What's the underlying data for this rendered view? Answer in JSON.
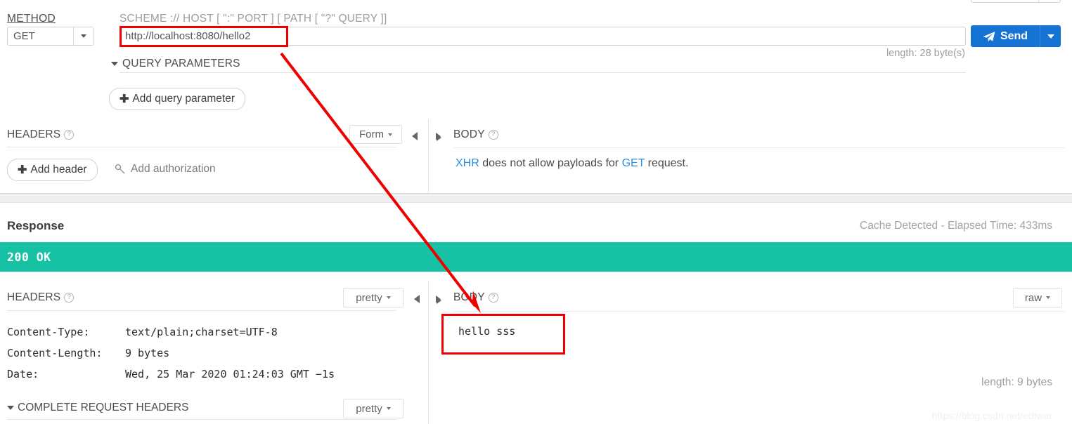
{
  "request": {
    "method_label": "METHOD",
    "method_value": "GET",
    "url_hint": "SCHEME :// HOST [ \":\" PORT ] [ PATH [ \"?\" QUERY ]]",
    "url_value": "http://localhost:8080/hello2",
    "url_placeholder": "http://localhost:8080/hello2",
    "url_length": "length: 28 byte(s)",
    "send_label": "Send",
    "send_icon": "paper-plane-icon",
    "query_parameters_label": "QUERY PARAMETERS",
    "add_query_parameter_label": "Add query parameter",
    "headers_label": "HEADERS",
    "headers_view_mode": "Form",
    "add_header_label": "Add header",
    "add_authorization_label": "Add authorization",
    "add_authorization_icon": "key-icon",
    "body_label": "BODY",
    "body_message_prefix": "XHR",
    "body_message_middle": " does not allow payloads for ",
    "body_message_link2": "GET",
    "body_message_suffix": " request."
  },
  "response": {
    "title": "Response",
    "meta": "Cache Detected - Elapsed Time: 433ms",
    "status_text": "200 OK",
    "status_color": "#17c2a4",
    "headers_label": "HEADERS",
    "headers_view_mode": "pretty",
    "headers": [
      {
        "key": "Content-Type:",
        "value": "text/plain;charset=UTF-8"
      },
      {
        "key": "Content-Length:",
        "value": "9 bytes"
      },
      {
        "key": "Date:",
        "value": "Wed, 25 Mar 2020 01:24:03 GMT −1s"
      }
    ],
    "body_label": "BODY",
    "body_view_mode": "raw",
    "body_content": "hello sss",
    "body_length": "length: 9 bytes",
    "complete_request_headers_label": "COMPLETE REQUEST HEADERS",
    "complete_request_headers_view_mode": "pretty"
  },
  "annotations": {
    "highlight_color": "#ee0000",
    "arrow_from": "url-input",
    "arrow_to": "response-body"
  },
  "watermark": "https://blog.csdn.net/edtwar",
  "theme": {
    "accent_blue": "#1573d6",
    "link_blue": "#2b8fe0",
    "status_green": "#17c2a4",
    "annotation_red": "#ee0000"
  }
}
